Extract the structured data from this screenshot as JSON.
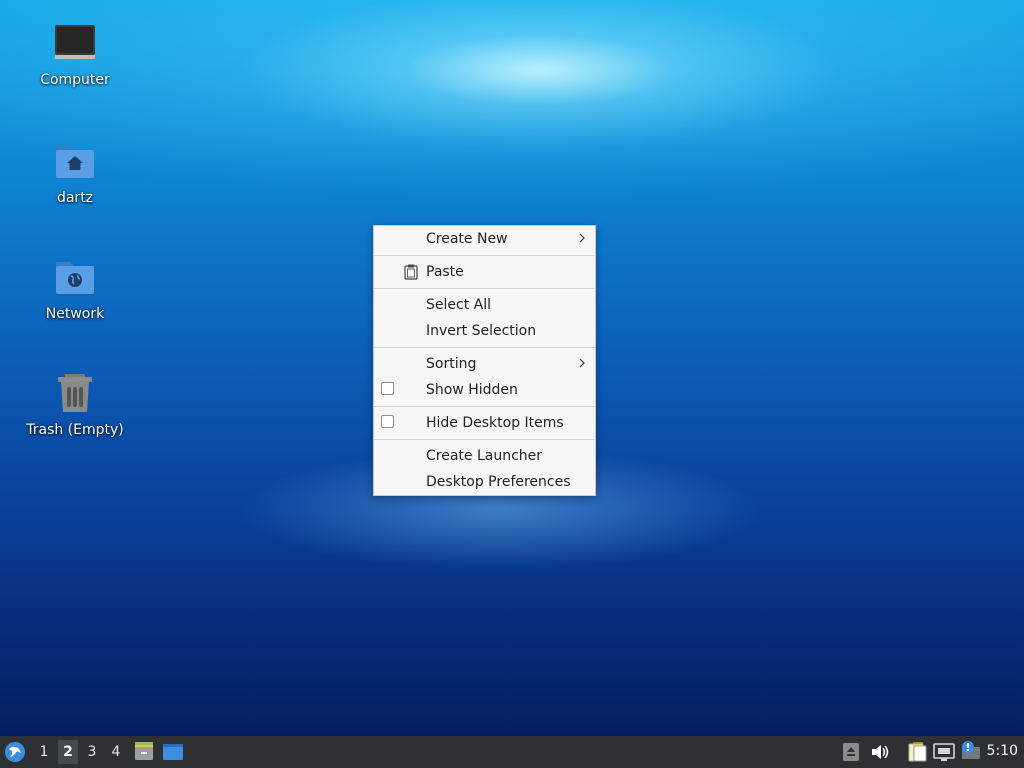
{
  "desktop": {
    "icons": [
      {
        "label": "Computer",
        "icon": "computer-icon"
      },
      {
        "label": "dartz",
        "icon": "home-folder-icon"
      },
      {
        "label": "Network",
        "icon": "network-folder-icon"
      },
      {
        "label": "Trash (Empty)",
        "icon": "trash-icon"
      }
    ]
  },
  "context_menu": {
    "create_new": "Create New",
    "paste": "Paste",
    "select_all": "Select All",
    "invert_selection": "Invert Selection",
    "sorting": "Sorting",
    "show_hidden": "Show Hidden",
    "hide_desktop_items": "Hide Desktop Items",
    "create_launcher": "Create Launcher",
    "desktop_preferences": "Desktop Preferences"
  },
  "taskbar": {
    "workspaces": [
      "1",
      "2",
      "3",
      "4"
    ],
    "active_workspace": "2",
    "clock": "5:10",
    "icons": [
      "start-menu-icon",
      "file-manager-icon",
      "show-desktop-icon",
      "eject-icon",
      "volume-icon",
      "clipboard-icon",
      "network-icon",
      "update-notifier-icon"
    ]
  },
  "colors": {
    "taskbar_bg": "#2e3134",
    "menu_bg": "#f6f6f6",
    "folder_blue": "#4a90d9"
  }
}
